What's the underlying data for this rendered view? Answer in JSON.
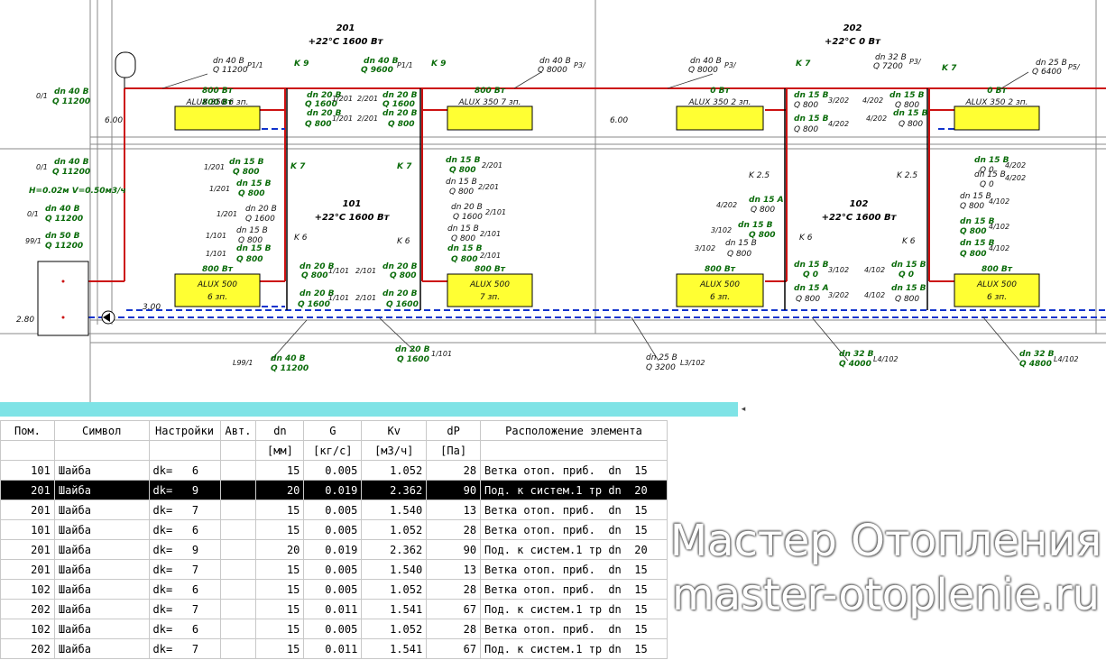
{
  "schematic": {
    "room_201": {
      "num": "201",
      "temp": "+22°C 1600 Вт"
    },
    "room_202": {
      "num": "202",
      "temp": "+22°C 0 Вт"
    },
    "room_101": {
      "num": "101",
      "temp": "+22°C 1600 Вт"
    },
    "room_102": {
      "num": "102",
      "temp": "+22°C 1600 Вт"
    },
    "radiators": {
      "r1": {
        "power": "800 Вт",
        "name": "ALUX 350 6 зп."
      },
      "r2": {
        "power": "800 Вт",
        "name": "ALUX 350 7 зп."
      },
      "r3": {
        "power": "0 Вт",
        "name": "ALUX 350 2 зп."
      },
      "r4": {
        "power": "0 Вт",
        "name": "ALUX 350 2 зп."
      },
      "r5": {
        "power": "800 Вт",
        "name": "ALUX 500",
        "sections": "6 зп."
      },
      "r6": {
        "power": "800 Вт",
        "name": "ALUX 500",
        "sections": "7 зп."
      },
      "r7": {
        "power": "800 Вт",
        "name": "ALUX 500",
        "sections": "6 зп."
      },
      "r8": {
        "power": "800 Вт",
        "name": "ALUX 500",
        "sections": "6 зп."
      }
    },
    "elev_600a": "6.00",
    "elev_600b": "6.00",
    "elev_300": "3.00",
    "elev_280": "2.80",
    "params": "H=0.02м  V=0.50м3/ч",
    "labels": {
      "l01": "dn 40 B",
      "l02": "Q 11200",
      "l03": "P1/1",
      "l04": "dn 40 B",
      "l05": "Q 9600",
      "l06": "P1/1",
      "l07": "dn 40 B",
      "l08": "Q 8000",
      "l09": "P3/",
      "l10": "dn 40 B",
      "l11": "Q 8000",
      "l12": "P3/",
      "l13": "dn 32 B",
      "l14": "Q 7200",
      "l15": "P3/",
      "l16": "dn 25 B",
      "l17": "Q 6400",
      "l18": "P5/",
      "l19": "0/1",
      "l20": "dn 40 B",
      "l21": "Q 11200",
      "l22": "0/1",
      "l23": "dn 40 B",
      "l24": "Q 11200",
      "l25": "0/1",
      "l26": "dn 40 B",
      "l27": "Q 11200",
      "l28": "99/1",
      "l29": "dn 50 B",
      "l30": "Q 11200",
      "k9a": "K  9",
      "k9b": "K  9",
      "k7a": "K  7",
      "k7b": "K  7",
      "k7c": "K  7",
      "k7d": "K  7",
      "k25a": "K  2.5",
      "k25b": "K  2.5",
      "k6a": "K  6",
      "k6b": "K  6",
      "k6c": "K  6",
      "k6d": "K  6",
      "p1": "dn 20 B",
      "p2": "Q 1600",
      "p3": "dn 20 B",
      "p4": "Q 1600",
      "p5": "dn 20 B",
      "p6": "Q 800",
      "p7": "dn 20 B",
      "p8": "Q 800",
      "t1": "1/201",
      "t2": "2/201",
      "t3": "1/201",
      "t4": "2/201",
      "s1": "dn 15 B",
      "s2": "Q 800",
      "s3": "dn 15 B",
      "s4": "Q 800",
      "s5": "1/201",
      "s6": "1/201",
      "s7": "1/201",
      "s8": "dn 20 B",
      "s9": "Q 1600",
      "s10": "1/101",
      "s11": "dn 15 B",
      "s12": "Q 800",
      "s13": "1/101",
      "s14": "dn 15 B",
      "s15": "Q 800",
      "u1": "dn 15 B",
      "u2": "Q 800",
      "u3": "2/201",
      "u4": "dn 15 B",
      "u5": "Q 800",
      "u6": "2/201",
      "u7": "dn 20 B",
      "u8": "Q 1600",
      "u9": "2/101",
      "u10": "dn 15 B",
      "u11": "Q 800",
      "u12": "2/101",
      "u13": "dn 15 B",
      "u14": "Q 800",
      "u15": "2/101",
      "m1": "dn 20 B",
      "m2": "Q 800",
      "m3": "1/101",
      "m4": "2/101",
      "m5": "dn 20 B",
      "m6": "Q 800",
      "m7": "dn 20 B",
      "m8": "Q 1600",
      "m9": "1/101",
      "m10": "2/101",
      "m11": "dn 20 B",
      "m12": "Q 1600",
      "b1": "L99/1",
      "b2": "dn 40 B",
      "b3": "Q 11200",
      "b4": "dn 20 B",
      "b5": "Q 1600",
      "b6": "1/101",
      "b7": "dn 25 B",
      "b8": "Q 3200",
      "b9": "L3/102",
      "b10": "dn 32 B",
      "b11": "Q 4000",
      "b12": "L4/102",
      "b13": "dn 32 B",
      "b14": "Q 4800",
      "b15": "L4/102",
      "r1a": "dn 15 B",
      "r1b": "Q 800",
      "r1c": "3/202",
      "r2a": "dn 15 B",
      "r2b": "Q 800",
      "r2c": "4/202",
      "r3a": "4/202",
      "r3b": "dn 15 B",
      "r3c": "Q 800",
      "r4a": "4/202",
      "r4b": "dn 15 B",
      "r4c": "Q 800",
      "r5a": "dn 15 B",
      "r5b": "Q 0",
      "r5c": "4/202",
      "r6a": "dn 15 B",
      "r6b": "Q 0",
      "r6c": "4/202",
      "r7a": "4/202",
      "r7b": "dn 15 A",
      "r7c": "Q 800",
      "r8a": "3/102",
      "r8b": "dn 15 B",
      "r8c": "Q 800",
      "r9a": "3/102",
      "r9b": "dn 15 B",
      "r9c": "Q 800",
      "q1a": "dn 15 B",
      "q1b": "Q 800",
      "q1c": "4/102",
      "q2a": "dn 15 B",
      "q2b": "Q 800",
      "q2c": "4/102",
      "q3a": "dn 15 B",
      "q3b": "Q 800",
      "q3c": "4/102",
      "v1a": "dn 15 B",
      "v1b": "Q 0",
      "v1c": "3/102",
      "v2a": "dn 15 A",
      "v2b": "Q 800",
      "v2c": "3/202",
      "v3a": "4/102",
      "v3b": "dn 15 B",
      "v3c": "Q 0",
      "v4a": "4/102",
      "v4b": "dn 15 B",
      "v4c": "Q 800"
    }
  },
  "table": {
    "headers": [
      "Пом.",
      "Символ",
      "Настройки",
      "Авт.",
      "dn",
      "G",
      "Kv",
      "dP",
      "Расположение элемента"
    ],
    "units": [
      "",
      "",
      "",
      "",
      "[мм]",
      "[кг/с]",
      "[м3/ч]",
      "[Па]",
      ""
    ],
    "rows": [
      [
        "101",
        "Шайба",
        "dk=   6",
        "",
        "15",
        "0.005",
        "1.052",
        "28",
        "Ветка отоп. приб.  dn  15"
      ],
      [
        "201",
        "Шайба",
        "dk=   9",
        "",
        "20",
        "0.019",
        "2.362",
        "90",
        "Под. к систем.1 тр dn  20"
      ],
      [
        "201",
        "Шайба",
        "dk=   7",
        "",
        "15",
        "0.005",
        "1.540",
        "13",
        "Ветка отоп. приб.  dn  15"
      ],
      [
        "101",
        "Шайба",
        "dk=   6",
        "",
        "15",
        "0.005",
        "1.052",
        "28",
        "Ветка отоп. приб.  dn  15"
      ],
      [
        "201",
        "Шайба",
        "dk=   9",
        "",
        "20",
        "0.019",
        "2.362",
        "90",
        "Под. к систем.1 тр dn  20"
      ],
      [
        "201",
        "Шайба",
        "dk=   7",
        "",
        "15",
        "0.005",
        "1.540",
        "13",
        "Ветка отоп. приб.  dn  15"
      ],
      [
        "102",
        "Шайба",
        "dk=   6",
        "",
        "15",
        "0.005",
        "1.052",
        "28",
        "Ветка отоп. приб.  dn  15"
      ],
      [
        "202",
        "Шайба",
        "dk=   7",
        "",
        "15",
        "0.011",
        "1.541",
        "67",
        "Под. к систем.1 тр dn  15"
      ],
      [
        "102",
        "Шайба",
        "dk=   6",
        "",
        "15",
        "0.005",
        "1.052",
        "28",
        "Ветка отоп. приб.  dn  15"
      ],
      [
        "202",
        "Шайба",
        "dk=   7",
        "",
        "15",
        "0.011",
        "1.541",
        "67",
        "Под. к систем.1 тр dn  15"
      ]
    ],
    "selected_row": 1
  },
  "watermark": {
    "line1": "Мастер Отопления",
    "line2": "master-otoplenie.ru"
  }
}
